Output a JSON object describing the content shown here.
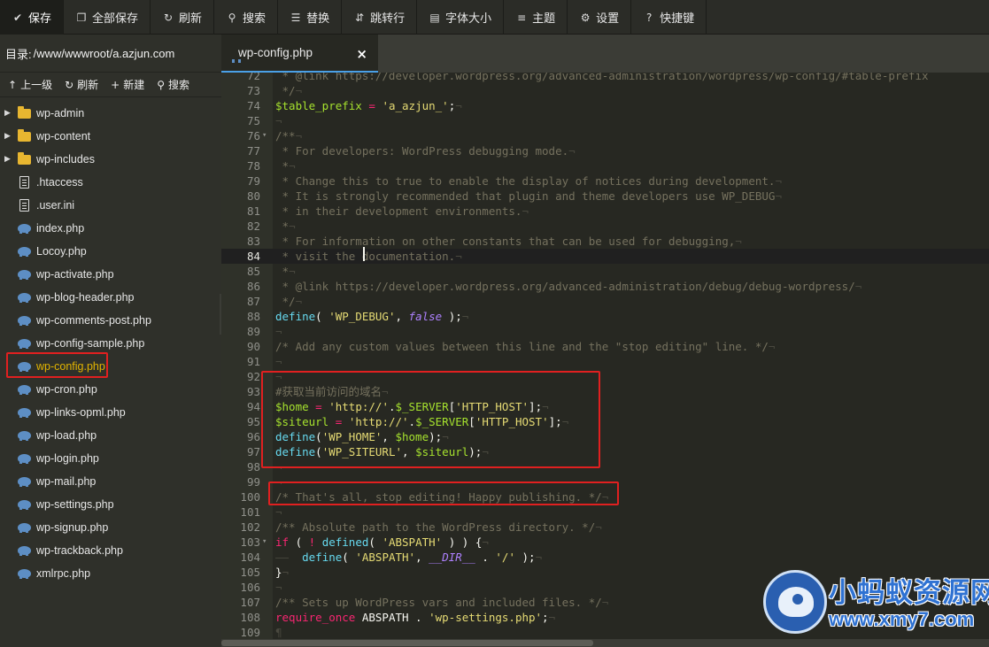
{
  "toolbar": {
    "items": [
      {
        "label": "保存",
        "icon": "check-icon"
      },
      {
        "label": "全部保存",
        "icon": "copy-icon"
      },
      {
        "label": "刷新",
        "icon": "refresh-icon"
      },
      {
        "label": "搜索",
        "icon": "search-icon"
      },
      {
        "label": "替换",
        "icon": "replace-icon"
      },
      {
        "label": "跳转行",
        "icon": "goto-line-icon"
      },
      {
        "label": "字体大小",
        "icon": "font-size-icon"
      },
      {
        "label": "主题",
        "icon": "theme-icon"
      },
      {
        "label": "设置",
        "icon": "gear-icon"
      },
      {
        "label": "快捷键",
        "icon": "help-icon"
      }
    ]
  },
  "sidebar": {
    "dir_label": "目录:",
    "dir_path": "/www/wwwroot/a.azjun.com",
    "actions": [
      {
        "label": "上一级",
        "icon": "up-arrow-icon"
      },
      {
        "label": "刷新",
        "icon": "refresh-icon"
      },
      {
        "label": "新建",
        "icon": "plus-icon"
      },
      {
        "label": "搜索",
        "icon": "search-icon"
      }
    ],
    "files": [
      {
        "name": "wp-admin",
        "type": "folder"
      },
      {
        "name": "wp-content",
        "type": "folder"
      },
      {
        "name": "wp-includes",
        "type": "folder"
      },
      {
        "name": ".htaccess",
        "type": "file"
      },
      {
        "name": ".user.ini",
        "type": "file"
      },
      {
        "name": "index.php",
        "type": "php"
      },
      {
        "name": "Locoy.php",
        "type": "php"
      },
      {
        "name": "wp-activate.php",
        "type": "php"
      },
      {
        "name": "wp-blog-header.php",
        "type": "php"
      },
      {
        "name": "wp-comments-post.php",
        "type": "php"
      },
      {
        "name": "wp-config-sample.php",
        "type": "php"
      },
      {
        "name": "wp-config.php",
        "type": "php",
        "active": true
      },
      {
        "name": "wp-cron.php",
        "type": "php"
      },
      {
        "name": "wp-links-opml.php",
        "type": "php"
      },
      {
        "name": "wp-load.php",
        "type": "php"
      },
      {
        "name": "wp-login.php",
        "type": "php"
      },
      {
        "name": "wp-mail.php",
        "type": "php"
      },
      {
        "name": "wp-settings.php",
        "type": "php"
      },
      {
        "name": "wp-signup.php",
        "type": "php"
      },
      {
        "name": "wp-trackback.php",
        "type": "php"
      },
      {
        "name": "xmlrpc.php",
        "type": "php"
      }
    ]
  },
  "editor": {
    "tab": {
      "title": "wp-config.php",
      "close": "×"
    },
    "active_line": 84,
    "lines": [
      {
        "n": "72",
        "tokens": [
          [
            "c-com",
            " * @link https://developer.wordpress.org/advanced-administration/wordpress/wp-config/#table-prefix"
          ]
        ]
      },
      {
        "n": "73",
        "tokens": [
          [
            "c-com",
            " */"
          ],
          [
            "c-inv",
            "¬"
          ]
        ]
      },
      {
        "n": "74",
        "tokens": [
          [
            "c-var",
            "$table_prefix"
          ],
          [
            "c-pl",
            " "
          ],
          [
            "c-op",
            "="
          ],
          [
            "c-pl",
            " "
          ],
          [
            "c-str",
            "'a_azjun_'"
          ],
          [
            "c-pl",
            ";"
          ],
          [
            "c-inv",
            "¬"
          ]
        ]
      },
      {
        "n": "75",
        "tokens": [
          [
            "c-inv",
            "¬"
          ]
        ]
      },
      {
        "n": "76",
        "fold": "▾",
        "tokens": [
          [
            "c-com",
            "/**"
          ],
          [
            "c-inv",
            "¬"
          ]
        ]
      },
      {
        "n": "77",
        "tokens": [
          [
            "c-com",
            " * For developers: WordPress debugging mode."
          ],
          [
            "c-inv",
            "¬"
          ]
        ]
      },
      {
        "n": "78",
        "tokens": [
          [
            "c-com",
            " *"
          ],
          [
            "c-inv",
            "¬"
          ]
        ]
      },
      {
        "n": "79",
        "tokens": [
          [
            "c-com",
            " * Change this to true to enable the display of notices during development."
          ],
          [
            "c-inv",
            "¬"
          ]
        ]
      },
      {
        "n": "80",
        "tokens": [
          [
            "c-com",
            " * It is strongly recommended that plugin and theme developers use WP_DEBUG"
          ],
          [
            "c-inv",
            "¬"
          ]
        ]
      },
      {
        "n": "81",
        "tokens": [
          [
            "c-com",
            " * in their development environments."
          ],
          [
            "c-inv",
            "¬"
          ]
        ]
      },
      {
        "n": "82",
        "tokens": [
          [
            "c-com",
            " *"
          ],
          [
            "c-inv",
            "¬"
          ]
        ]
      },
      {
        "n": "83",
        "tokens": [
          [
            "c-com",
            " * For information on other constants that can be used for debugging,"
          ],
          [
            "c-inv",
            "¬"
          ]
        ]
      },
      {
        "n": "84",
        "tokens": [
          [
            "c-com",
            " * visit the documentation."
          ],
          [
            "c-inv",
            "¬"
          ]
        ]
      },
      {
        "n": "85",
        "tokens": [
          [
            "c-com",
            " *"
          ],
          [
            "c-inv",
            "¬"
          ]
        ]
      },
      {
        "n": "86",
        "tokens": [
          [
            "c-com",
            " * @link https://developer.wordpress.org/advanced-administration/debug/debug-wordpress/"
          ],
          [
            "c-inv",
            "¬"
          ]
        ]
      },
      {
        "n": "87",
        "tokens": [
          [
            "c-com",
            " */"
          ],
          [
            "c-inv",
            "¬"
          ]
        ]
      },
      {
        "n": "88",
        "tokens": [
          [
            "c-fn",
            "define"
          ],
          [
            "c-pl",
            "( "
          ],
          [
            "c-str",
            "'WP_DEBUG'"
          ],
          [
            "c-pl",
            ", "
          ],
          [
            "c-con",
            "false"
          ],
          [
            "c-pl",
            " );"
          ],
          [
            "c-inv",
            "¬"
          ]
        ]
      },
      {
        "n": "89",
        "tokens": [
          [
            "c-inv",
            "¬"
          ]
        ]
      },
      {
        "n": "90",
        "tokens": [
          [
            "c-com",
            "/* Add any custom values between this line and the \"stop editing\" line. */"
          ],
          [
            "c-inv",
            "¬"
          ]
        ]
      },
      {
        "n": "91",
        "tokens": [
          [
            "c-inv",
            "¬"
          ]
        ]
      },
      {
        "n": "92",
        "tokens": [
          [
            "c-inv",
            "¬"
          ]
        ]
      },
      {
        "n": "93",
        "tokens": [
          [
            "c-com",
            "#获取当前访问的域名"
          ],
          [
            "c-inv",
            "¬"
          ]
        ]
      },
      {
        "n": "94",
        "tokens": [
          [
            "c-var",
            "$home"
          ],
          [
            "c-pl",
            " "
          ],
          [
            "c-op",
            "="
          ],
          [
            "c-pl",
            " "
          ],
          [
            "c-str",
            "'http://'"
          ],
          [
            "c-pl",
            "."
          ],
          [
            "c-var",
            "$_SERVER"
          ],
          [
            "c-pl",
            "["
          ],
          [
            "c-str",
            "'HTTP_HOST'"
          ],
          [
            "c-pl",
            "];"
          ],
          [
            "c-inv",
            "¬"
          ]
        ]
      },
      {
        "n": "95",
        "tokens": [
          [
            "c-var",
            "$siteurl"
          ],
          [
            "c-pl",
            " "
          ],
          [
            "c-op",
            "="
          ],
          [
            "c-pl",
            " "
          ],
          [
            "c-str",
            "'http://'"
          ],
          [
            "c-pl",
            "."
          ],
          [
            "c-var",
            "$_SERVER"
          ],
          [
            "c-pl",
            "["
          ],
          [
            "c-str",
            "'HTTP_HOST'"
          ],
          [
            "c-pl",
            "];"
          ],
          [
            "c-inv",
            "¬"
          ]
        ]
      },
      {
        "n": "96",
        "tokens": [
          [
            "c-fn",
            "define"
          ],
          [
            "c-pl",
            "("
          ],
          [
            "c-str",
            "'WP_HOME'"
          ],
          [
            "c-pl",
            ", "
          ],
          [
            "c-var",
            "$home"
          ],
          [
            "c-pl",
            ");"
          ],
          [
            "c-inv",
            "¬"
          ]
        ]
      },
      {
        "n": "97",
        "tokens": [
          [
            "c-fn",
            "define"
          ],
          [
            "c-pl",
            "("
          ],
          [
            "c-str",
            "'WP_SITEURL'"
          ],
          [
            "c-pl",
            ", "
          ],
          [
            "c-var",
            "$siteurl"
          ],
          [
            "c-pl",
            ");"
          ],
          [
            "c-inv",
            "¬"
          ]
        ]
      },
      {
        "n": "98",
        "tokens": [
          [
            "c-inv",
            "¬"
          ]
        ]
      },
      {
        "n": "99",
        "tokens": [
          [
            "c-inv",
            "¬"
          ]
        ]
      },
      {
        "n": "100",
        "tokens": [
          [
            "c-com",
            "/* That's all, stop editing! Happy publishing. */"
          ],
          [
            "c-inv",
            "¬"
          ]
        ]
      },
      {
        "n": "101",
        "tokens": [
          [
            "c-inv",
            "¬"
          ]
        ]
      },
      {
        "n": "102",
        "tokens": [
          [
            "c-com",
            "/** Absolute path to the WordPress directory. */"
          ],
          [
            "c-inv",
            "¬"
          ]
        ]
      },
      {
        "n": "103",
        "fold": "▾",
        "tokens": [
          [
            "c-kw",
            "if"
          ],
          [
            "c-pl",
            " ( "
          ],
          [
            "c-op",
            "!"
          ],
          [
            "c-pl",
            " "
          ],
          [
            "c-fn",
            "defined"
          ],
          [
            "c-pl",
            "( "
          ],
          [
            "c-str",
            "'ABSPATH'"
          ],
          [
            "c-pl",
            " ) ) {"
          ],
          [
            "c-inv",
            "¬"
          ]
        ]
      },
      {
        "n": "104",
        "tokens": [
          [
            "c-inv",
            "——"
          ],
          [
            "c-pl",
            "  "
          ],
          [
            "c-fn",
            "define"
          ],
          [
            "c-pl",
            "( "
          ],
          [
            "c-str",
            "'ABSPATH'"
          ],
          [
            "c-pl",
            ", "
          ],
          [
            "c-con",
            "__DIR__"
          ],
          [
            "c-pl",
            " . "
          ],
          [
            "c-str",
            "'/'"
          ],
          [
            "c-pl",
            " );"
          ],
          [
            "c-inv",
            "¬"
          ]
        ]
      },
      {
        "n": "105",
        "tokens": [
          [
            "c-pl",
            "}"
          ],
          [
            "c-inv",
            "¬"
          ]
        ]
      },
      {
        "n": "106",
        "tokens": [
          [
            "c-inv",
            "¬"
          ]
        ]
      },
      {
        "n": "107",
        "tokens": [
          [
            "c-com",
            "/** Sets up WordPress vars and included files. */"
          ],
          [
            "c-inv",
            "¬"
          ]
        ]
      },
      {
        "n": "108",
        "tokens": [
          [
            "c-kw",
            "require_once"
          ],
          [
            "c-pl",
            " ABSPATH . "
          ],
          [
            "c-str",
            "'wp-settings.php'"
          ],
          [
            "c-pl",
            ";"
          ],
          [
            "c-inv",
            "¬"
          ]
        ]
      },
      {
        "n": "109",
        "tokens": [
          [
            "c-inv",
            "¶"
          ]
        ]
      }
    ]
  },
  "watermark": {
    "title": "小蚂蚁资源网",
    "url": "www.xmy7.com"
  }
}
